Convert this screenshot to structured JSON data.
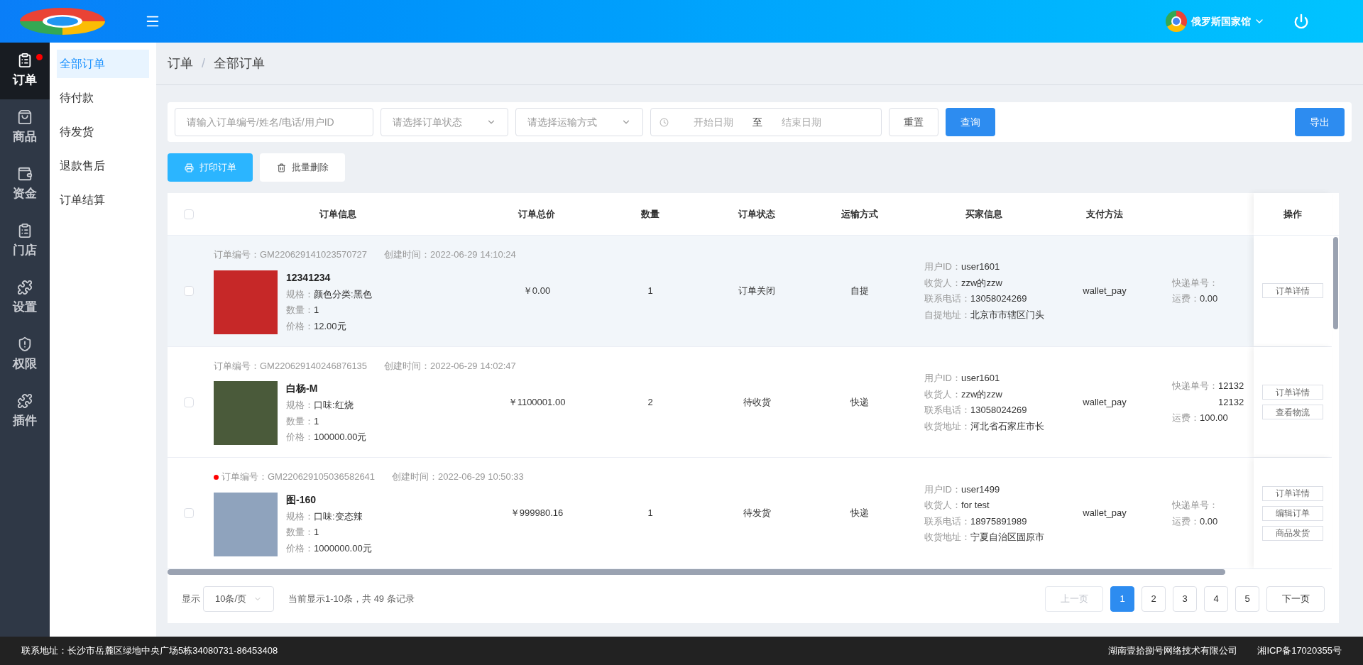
{
  "header": {
    "user_name": "俄罗斯国家馆"
  },
  "nav": [
    {
      "label": "订单",
      "selected": true,
      "dot": true
    },
    {
      "label": "商品",
      "selected": false,
      "dot": false
    },
    {
      "label": "资金",
      "selected": false,
      "dot": false
    },
    {
      "label": "门店",
      "selected": false,
      "dot": false
    },
    {
      "label": "设置",
      "selected": false,
      "dot": false
    },
    {
      "label": "权限",
      "selected": false,
      "dot": false
    },
    {
      "label": "插件",
      "selected": false,
      "dot": false
    }
  ],
  "submenu": [
    {
      "label": "全部订单",
      "selected": true
    },
    {
      "label": "待付款",
      "selected": false
    },
    {
      "label": "待发货",
      "selected": false
    },
    {
      "label": "退款售后",
      "selected": false
    },
    {
      "label": "订单结算",
      "selected": false
    }
  ],
  "breadcrumb": [
    "订单",
    "全部订单"
  ],
  "breadcrumb_separator": "/",
  "filters": {
    "search": {
      "placeholder": "请输入订单编号/姓名/电话/用户ID"
    },
    "status": {
      "placeholder": "请选择订单状态"
    },
    "shipping": {
      "placeholder": "请选择运输方式"
    },
    "date_start": {
      "placeholder": "开始日期"
    },
    "date_separator": "至",
    "date_end": {
      "placeholder": "结束日期"
    },
    "reset": "重置",
    "query": "查询",
    "export": "导出"
  },
  "actions": [
    {
      "label": "打印订单",
      "kind": "print"
    },
    {
      "label": "批量删除",
      "kind": "delete"
    }
  ],
  "table": {
    "select_all_checked": false,
    "columns": [
      "订单信息",
      "订单总价",
      "数量",
      "订单状态",
      "运输方式",
      "买家信息",
      "支付方法"
    ],
    "action_column": "操作",
    "rows": [
      {
        "highlighted": true,
        "checked": false,
        "unread": false,
        "order_no_label": "订单编号：",
        "order_no": "GM220629141023570727",
        "created_label": "创建时间：",
        "created": "2022-06-29 14:10:24",
        "product": "12341234",
        "spec_label": "规格：",
        "spec": "颜色分类:黑色",
        "qty_label": "数量：",
        "qty": "1",
        "price_label": "价格：",
        "price": "12.00元",
        "total": "￥0.00",
        "quantity": "1",
        "status": "订单关闭",
        "shipping": "自提",
        "buyer": [
          {
            "label": "用户ID：",
            "value": "user1601"
          },
          {
            "label": "收货人：",
            "value": "zzw的zzw"
          },
          {
            "label": "联系电话：",
            "value": "13058024269"
          },
          {
            "label": "自提地址：",
            "value": "北京市市辖区门头"
          }
        ],
        "pay": "wallet_pay",
        "tracking_label": "快递单号：",
        "tracking": [],
        "freight_label": "运费：",
        "freight": "0.00",
        "ops": [
          "订单详情"
        ]
      },
      {
        "highlighted": false,
        "checked": false,
        "unread": false,
        "order_no_label": "订单编号：",
        "order_no": "GM220629140246876135",
        "created_label": "创建时间：",
        "created": "2022-06-29 14:02:47",
        "product": "白杨-M",
        "spec_label": "规格：",
        "spec": "口味:红烧",
        "qty_label": "数量：",
        "qty": "1",
        "price_label": "价格：",
        "price": "100000.00元",
        "total": "￥1100001.00",
        "quantity": "2",
        "status": "待收货",
        "shipping": "快递",
        "buyer": [
          {
            "label": "用户ID：",
            "value": "user1601"
          },
          {
            "label": "收货人：",
            "value": "zzw的zzw"
          },
          {
            "label": "联系电话：",
            "value": "13058024269"
          },
          {
            "label": "收货地址：",
            "value": "河北省石家庄市长"
          }
        ],
        "pay": "wallet_pay",
        "tracking_label": "快递单号：",
        "tracking": [
          "12132",
          "12132"
        ],
        "freight_label": "运费：",
        "freight": "100.00",
        "ops": [
          "订单详情",
          "查看物流"
        ]
      },
      {
        "highlighted": false,
        "checked": false,
        "unread": true,
        "order_no_label": "订单编号：",
        "order_no": "GM220629105036582641",
        "created_label": "创建时间：",
        "created": "2022-06-29 10:50:33",
        "product": "图-160",
        "spec_label": "规格：",
        "spec": "口味:变态辣",
        "qty_label": "数量：",
        "qty": "1",
        "price_label": "价格：",
        "price": "1000000.00元",
        "total": "￥999980.16",
        "quantity": "1",
        "status": "待发货",
        "shipping": "快递",
        "buyer": [
          {
            "label": "用户ID：",
            "value": "user1499"
          },
          {
            "label": "收货人：",
            "value": "for test"
          },
          {
            "label": "联系电话：",
            "value": "18975891989"
          },
          {
            "label": "收货地址：",
            "value": "宁夏自治区固原市"
          }
        ],
        "pay": "wallet_pay",
        "tracking_label": "快递单号：",
        "tracking": [],
        "freight_label": "运费：",
        "freight": "0.00",
        "ops": [
          "订单详情",
          "编辑订单",
          "商品发货"
        ]
      }
    ]
  },
  "pagination": {
    "show_label": "显示",
    "page_size": "10条/页",
    "summary": "当前显示1-10条，共 49 条记录",
    "prev": {
      "label": "上一页",
      "disabled": true
    },
    "pages": [
      {
        "label": "1",
        "selected": true
      },
      {
        "label": "2",
        "selected": false
      },
      {
        "label": "3",
        "selected": false
      },
      {
        "label": "4",
        "selected": false
      },
      {
        "label": "5",
        "selected": false
      }
    ],
    "next": {
      "label": "下一页",
      "disabled": false
    }
  },
  "footer": {
    "address": "联系地址：长沙市岳麓区绿地中央广场5栋34080731-86453408",
    "company": "湖南壹拾捌号网络技术有限公司",
    "icp": "湘ICP备17020355号"
  }
}
